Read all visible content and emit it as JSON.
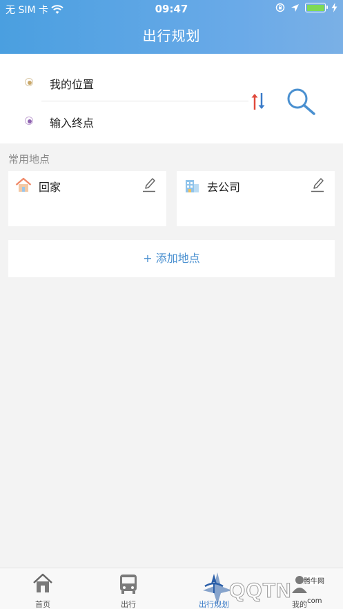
{
  "status_bar": {
    "carrier": "无 SIM 卡",
    "time": "09:47"
  },
  "header": {
    "title": "出行规划"
  },
  "route": {
    "start_label": "我的位置",
    "end_placeholder": "输入终点",
    "swap_icon": "swap-icon",
    "search_icon": "search-icon"
  },
  "common_places": {
    "title": "常用地点",
    "items": [
      {
        "label": "回家",
        "icon": "home-icon"
      },
      {
        "label": "去公司",
        "icon": "building-icon"
      }
    ],
    "add_label": "+ 添加地点"
  },
  "tabbar": {
    "items": [
      {
        "label": "首页",
        "icon": "home-tab-icon"
      },
      {
        "label": "出行",
        "icon": "bus-icon"
      },
      {
        "label": "出行规划",
        "icon": "plan-icon",
        "active": true
      },
      {
        "label": "我的",
        "icon": "profile-icon"
      }
    ]
  },
  "watermark": {
    "text": "QQTN",
    "small": "腾牛网",
    "suffix": ".com"
  },
  "colors": {
    "header_gradient_start": "#4a9fe0",
    "header_gradient_end": "#7ab0e6",
    "accent": "#4a90d0",
    "active_tab": "#3a7bc8",
    "background": "#f3f3f3"
  }
}
